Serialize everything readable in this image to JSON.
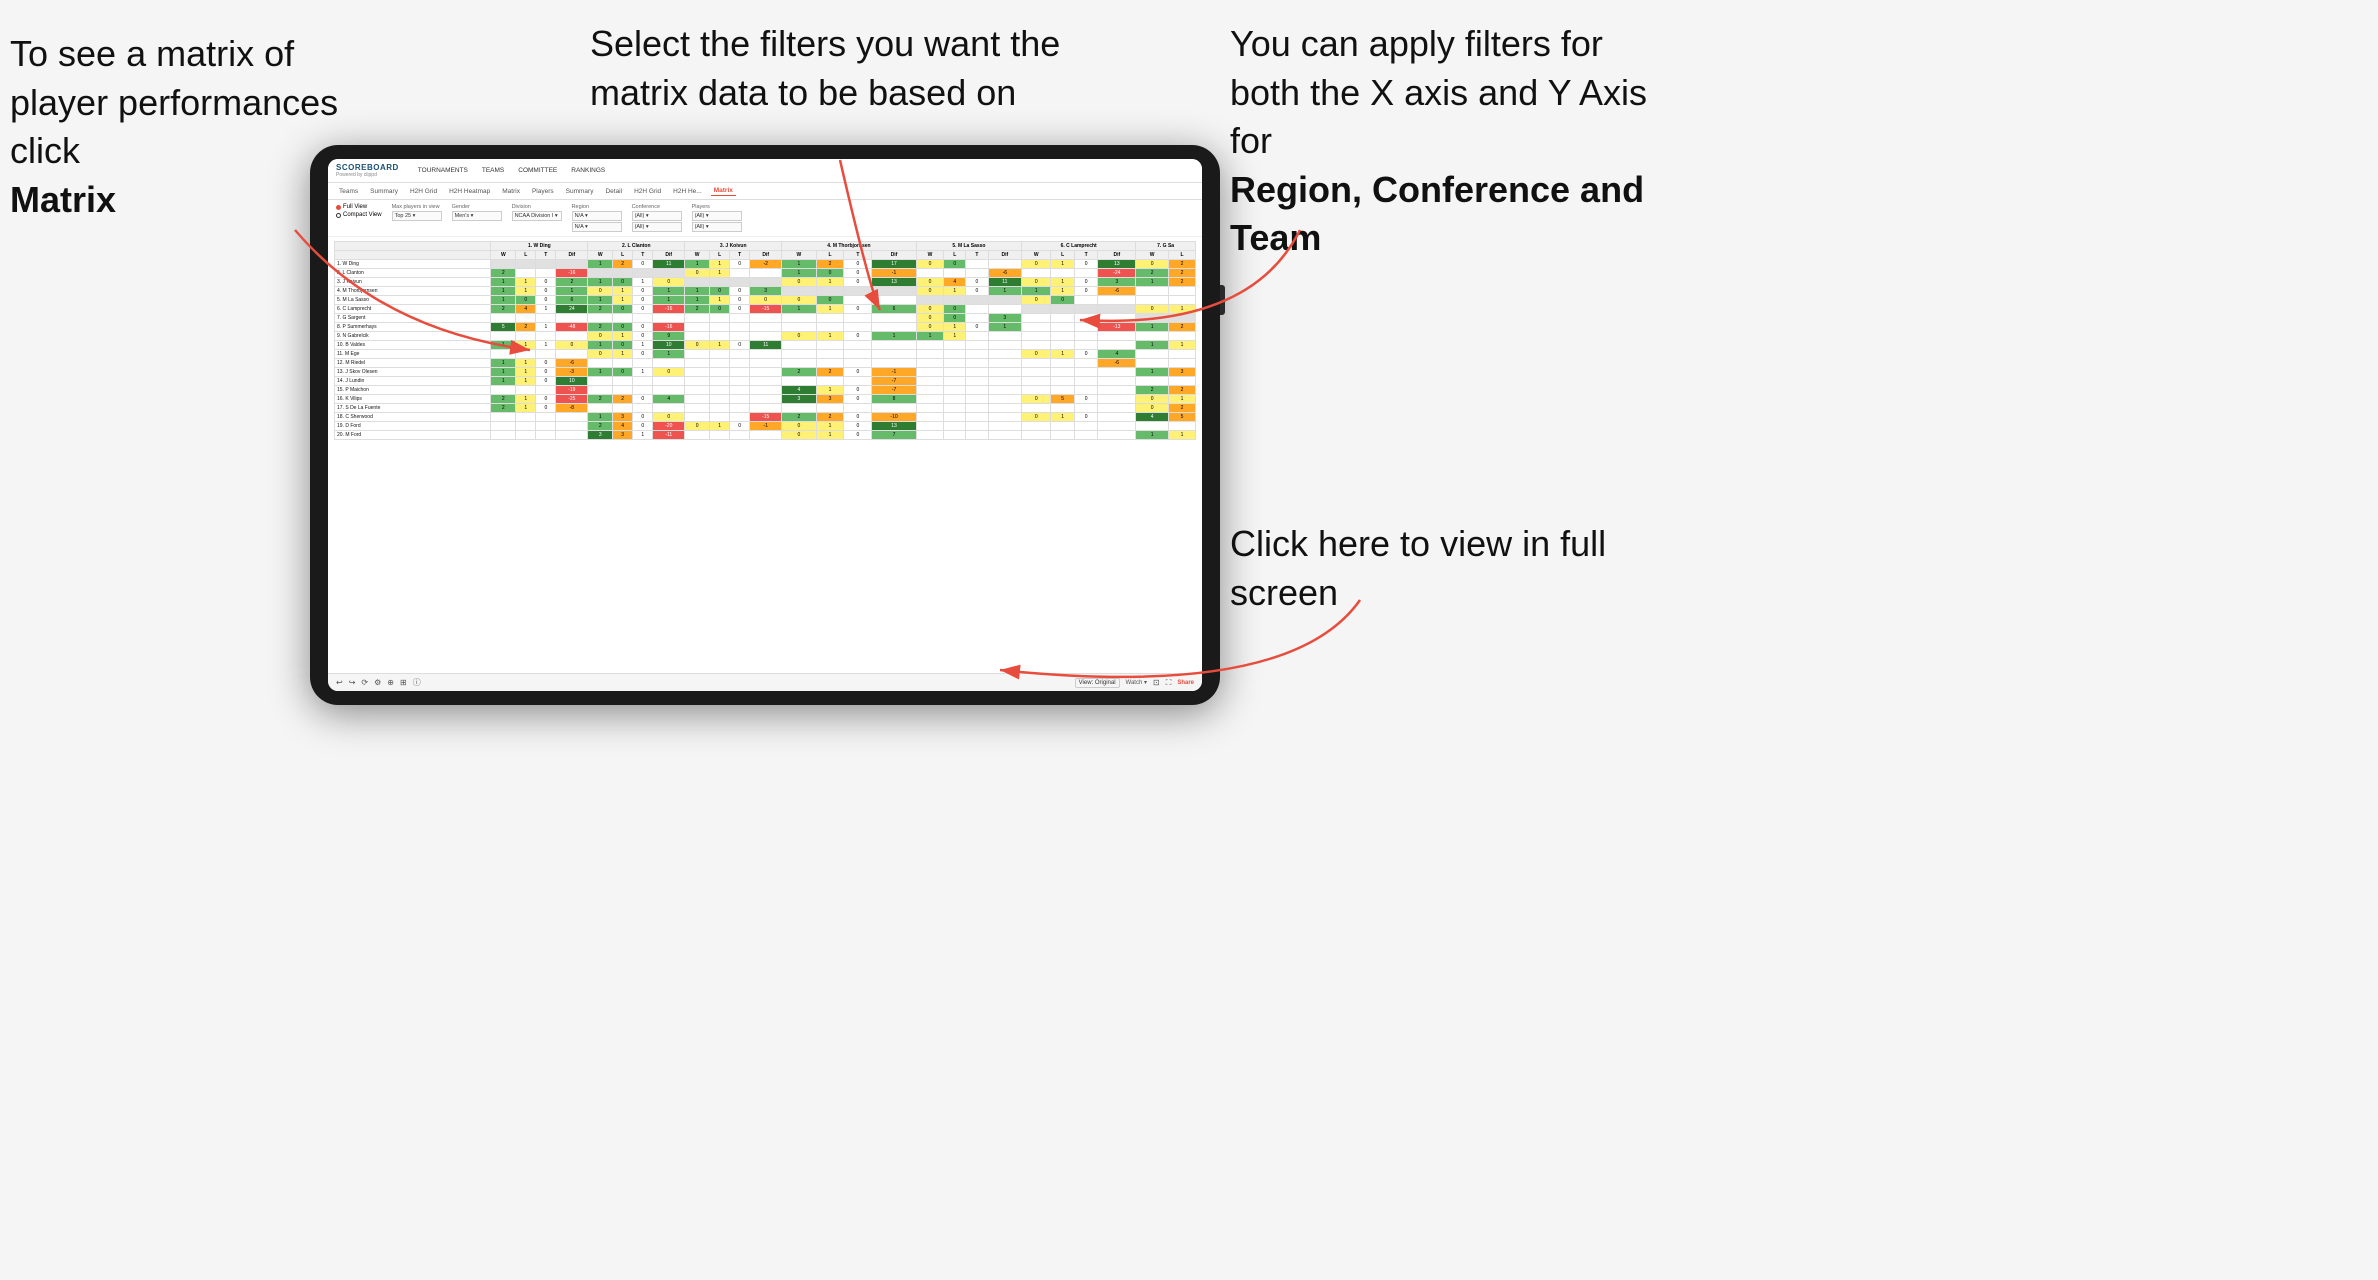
{
  "annotations": {
    "matrix_label": "To see a matrix of player performances click",
    "matrix_bold": "Matrix",
    "filters_label": "Select the filters you want the matrix data to be based on",
    "axes_label": "You  can apply filters for both the X axis and Y Axis for",
    "axes_bold": "Region, Conference and Team",
    "fullscreen_label": "Click here to view in full screen"
  },
  "nav": {
    "logo": "SCOREBOARD",
    "logo_sub": "Powered by clippd",
    "items": [
      "TOURNAMENTS",
      "TEAMS",
      "COMMITTEE",
      "RANKINGS"
    ]
  },
  "subnav": {
    "items": [
      "Teams",
      "Summary",
      "H2H Grid",
      "H2H Heatmap",
      "Matrix",
      "Players",
      "Summary",
      "Detail",
      "H2H Grid",
      "H2H He...",
      "Matrix"
    ],
    "active_index": 10
  },
  "filters": {
    "view_options": [
      "Full View",
      "Compact View"
    ],
    "active_view": 0,
    "max_players": {
      "label": "Max players in view",
      "value": "Top 25"
    },
    "gender": {
      "label": "Gender",
      "value": "Men's"
    },
    "division": {
      "label": "Division",
      "value": "NCAA Division I"
    },
    "region": {
      "label": "Region",
      "value": "N/A",
      "value2": "N/A"
    },
    "conference": {
      "label": "Conference",
      "value": "(All)",
      "value2": "(All)"
    },
    "players": {
      "label": "Players",
      "value": "(All)",
      "value2": "(All)"
    }
  },
  "matrix": {
    "col_groups": [
      {
        "name": "1. W Ding",
        "cols": [
          "W",
          "L",
          "T",
          "Dif"
        ]
      },
      {
        "name": "2. L Clanton",
        "cols": [
          "W",
          "L",
          "T",
          "Dif"
        ]
      },
      {
        "name": "3. J Koivun",
        "cols": [
          "W",
          "L",
          "T",
          "Dif"
        ]
      },
      {
        "name": "4. M Thorbjornsen",
        "cols": [
          "W",
          "L",
          "T",
          "Dif"
        ]
      },
      {
        "name": "5. M La Sasso",
        "cols": [
          "W",
          "L",
          "T",
          "Dif"
        ]
      },
      {
        "name": "6. C Lamprecht",
        "cols": [
          "W",
          "L",
          "T",
          "Dif"
        ]
      },
      {
        "name": "7. G Sa",
        "cols": [
          "W",
          "L"
        ]
      }
    ],
    "rows": [
      {
        "name": "1. W Ding",
        "data": [
          [
            null,
            null,
            null,
            null
          ],
          [
            1,
            2,
            0,
            11
          ],
          [
            1,
            1,
            0,
            -2
          ],
          [
            1,
            2,
            0,
            17
          ],
          [
            0,
            0,
            null,
            null
          ],
          [
            0,
            1,
            0,
            13
          ],
          [
            0,
            2,
            null,
            null
          ]
        ]
      },
      {
        "name": "2. L Clanton",
        "data": [
          [
            2,
            null,
            null,
            -16
          ],
          [
            null,
            null,
            null,
            null
          ],
          [
            0,
            1,
            null,
            null
          ],
          [
            1,
            0,
            0,
            -1
          ],
          [
            null,
            null,
            null,
            -6
          ],
          [
            null,
            null,
            null,
            -24
          ],
          [
            2,
            2,
            null,
            null
          ]
        ]
      },
      {
        "name": "3. J Koivun",
        "data": [
          [
            1,
            1,
            0,
            2
          ],
          [
            1,
            0,
            1,
            0
          ],
          [
            null,
            null,
            null,
            null
          ],
          [
            0,
            1,
            0,
            13
          ],
          [
            0,
            4,
            0,
            11
          ],
          [
            0,
            1,
            0,
            3
          ],
          [
            1,
            2,
            null,
            null
          ]
        ]
      },
      {
        "name": "4. M Thorbjornsen",
        "data": [
          [
            1,
            1,
            0,
            1
          ],
          [
            0,
            1,
            0,
            1
          ],
          [
            1,
            0,
            0,
            3
          ],
          [
            null,
            null,
            null,
            null
          ],
          [
            0,
            1,
            0,
            1
          ],
          [
            1,
            1,
            0,
            -6
          ],
          [
            null,
            null,
            null,
            null
          ]
        ]
      },
      {
        "name": "5. M La Sasso",
        "data": [
          [
            1,
            0,
            0,
            6
          ],
          [
            1,
            1,
            0,
            1
          ],
          [
            1,
            1,
            0,
            0
          ],
          [
            0,
            0,
            null,
            null
          ],
          [
            null,
            null,
            null,
            null
          ],
          [
            0,
            0,
            null,
            null
          ],
          [
            null,
            null,
            null,
            null
          ]
        ]
      },
      {
        "name": "6. C Lamprecht",
        "data": [
          [
            2,
            4,
            1,
            24
          ],
          [
            2,
            0,
            0,
            -16
          ],
          [
            2,
            0,
            0,
            -15
          ],
          [
            1,
            1,
            0,
            6
          ],
          [
            0,
            0,
            null,
            null
          ],
          [
            null,
            null,
            null,
            null
          ],
          [
            0,
            1,
            null,
            null
          ]
        ]
      },
      {
        "name": "7. G Sargent",
        "data": [
          [
            null,
            null,
            null,
            null
          ],
          [
            null,
            null,
            null,
            null
          ],
          [
            null,
            null,
            null,
            null
          ],
          [
            null,
            null,
            null,
            null
          ],
          [
            0,
            0,
            null,
            3
          ],
          [
            null,
            null,
            null,
            null
          ],
          [
            null,
            null,
            null,
            null
          ]
        ]
      },
      {
        "name": "8. P Summerhays",
        "data": [
          [
            5,
            2,
            1,
            -48
          ],
          [
            2,
            0,
            0,
            -16
          ],
          [
            null,
            null,
            null,
            null
          ],
          [
            null,
            null,
            null,
            null
          ],
          [
            0,
            1,
            0,
            1
          ],
          [
            null,
            null,
            null,
            -13
          ],
          [
            1,
            2,
            null,
            null
          ]
        ]
      },
      {
        "name": "9. N Gabrelcik",
        "data": [
          [
            null,
            null,
            null,
            null
          ],
          [
            0,
            1,
            0,
            9
          ],
          [
            null,
            null,
            null,
            null
          ],
          [
            0,
            1,
            0,
            1
          ],
          [
            1,
            1,
            null,
            null
          ],
          [
            null,
            null,
            null,
            null
          ],
          [
            null,
            null,
            null,
            null
          ]
        ]
      },
      {
        "name": "10. B Valdes",
        "data": [
          [
            1,
            1,
            1,
            0
          ],
          [
            1,
            0,
            1,
            10
          ],
          [
            0,
            1,
            0,
            11
          ],
          [
            null,
            null,
            null,
            null
          ],
          [
            null,
            null,
            null,
            null
          ],
          [
            null,
            null,
            null,
            null
          ],
          [
            1,
            1,
            null,
            null
          ]
        ]
      },
      {
        "name": "11. M Ege",
        "data": [
          [
            null,
            null,
            null,
            null
          ],
          [
            0,
            1,
            0,
            1
          ],
          [
            null,
            null,
            null,
            null
          ],
          [
            null,
            null,
            null,
            null
          ],
          [
            null,
            null,
            null,
            null
          ],
          [
            0,
            1,
            0,
            4
          ],
          [
            null,
            null,
            null,
            null
          ]
        ]
      },
      {
        "name": "12. M Riedel",
        "data": [
          [
            1,
            1,
            0,
            -6
          ],
          [
            null,
            null,
            null,
            null
          ],
          [
            null,
            null,
            null,
            null
          ],
          [
            null,
            null,
            null,
            null
          ],
          [
            null,
            null,
            null,
            null
          ],
          [
            null,
            null,
            null,
            -6
          ],
          [
            null,
            null,
            null,
            null
          ]
        ]
      },
      {
        "name": "13. J Skov Olesen",
        "data": [
          [
            1,
            1,
            0,
            -3
          ],
          [
            1,
            0,
            1,
            0
          ],
          [
            null,
            null,
            null,
            null
          ],
          [
            2,
            2,
            0,
            -1
          ],
          [
            null,
            null,
            null,
            null
          ],
          [
            null,
            null,
            null,
            null
          ],
          [
            1,
            3,
            null,
            null
          ]
        ]
      },
      {
        "name": "14. J Lundin",
        "data": [
          [
            1,
            1,
            0,
            10
          ],
          [
            null,
            null,
            null,
            null
          ],
          [
            null,
            null,
            null,
            null
          ],
          [
            null,
            null,
            null,
            -7
          ],
          [
            null,
            null,
            null,
            null
          ],
          [
            null,
            null,
            null,
            null
          ],
          [
            null,
            null,
            null,
            null
          ]
        ]
      },
      {
        "name": "15. P Maichon",
        "data": [
          [
            null,
            null,
            null,
            -19
          ],
          [
            null,
            null,
            null,
            null
          ],
          [
            null,
            null,
            null,
            null
          ],
          [
            4,
            1,
            0,
            -7
          ],
          [
            null,
            null,
            null,
            null
          ],
          [
            null,
            null,
            null,
            null
          ],
          [
            2,
            2,
            null,
            null
          ]
        ]
      },
      {
        "name": "16. K Vilips",
        "data": [
          [
            2,
            1,
            0,
            -25
          ],
          [
            2,
            2,
            0,
            4
          ],
          [
            null,
            null,
            null,
            null
          ],
          [
            3,
            3,
            0,
            8
          ],
          [
            null,
            null,
            null,
            null
          ],
          [
            0,
            5,
            0,
            null
          ],
          [
            0,
            1,
            null,
            null
          ]
        ]
      },
      {
        "name": "17. S De La Fuente",
        "data": [
          [
            2,
            1,
            0,
            -8
          ],
          [
            null,
            null,
            null,
            null
          ],
          [
            null,
            null,
            null,
            null
          ],
          [
            null,
            null,
            null,
            null
          ],
          [
            null,
            null,
            null,
            null
          ],
          [
            null,
            null,
            null,
            null
          ],
          [
            0,
            2,
            null,
            null
          ]
        ]
      },
      {
        "name": "18. C Sherwood",
        "data": [
          [
            null,
            null,
            null,
            null
          ],
          [
            1,
            3,
            0,
            0
          ],
          [
            null,
            null,
            null,
            -15
          ],
          [
            2,
            2,
            0,
            -10
          ],
          [
            null,
            null,
            null,
            null
          ],
          [
            0,
            1,
            0,
            null
          ],
          [
            4,
            5,
            null,
            null
          ]
        ]
      },
      {
        "name": "19. D Ford",
        "data": [
          [
            null,
            null,
            null,
            null
          ],
          [
            2,
            4,
            0,
            -20
          ],
          [
            0,
            1,
            0,
            -1
          ],
          [
            0,
            1,
            0,
            13
          ],
          [
            null,
            null,
            null,
            null
          ],
          [
            null,
            null,
            null,
            null
          ],
          [
            null,
            null,
            null,
            null
          ]
        ]
      },
      {
        "name": "20. M Ford",
        "data": [
          [
            null,
            null,
            null,
            null
          ],
          [
            3,
            3,
            1,
            -11
          ],
          [
            null,
            null,
            null,
            null
          ],
          [
            0,
            1,
            0,
            7
          ],
          [
            null,
            null,
            null,
            null
          ],
          [
            null,
            null,
            null,
            null
          ],
          [
            1,
            1,
            null,
            null
          ]
        ]
      }
    ]
  },
  "toolbar": {
    "view_label": "View: Original",
    "watch": "Watch ▾",
    "share": "Share"
  },
  "colors": {
    "accent": "#e74c3c",
    "nav_blue": "#1a5276"
  }
}
